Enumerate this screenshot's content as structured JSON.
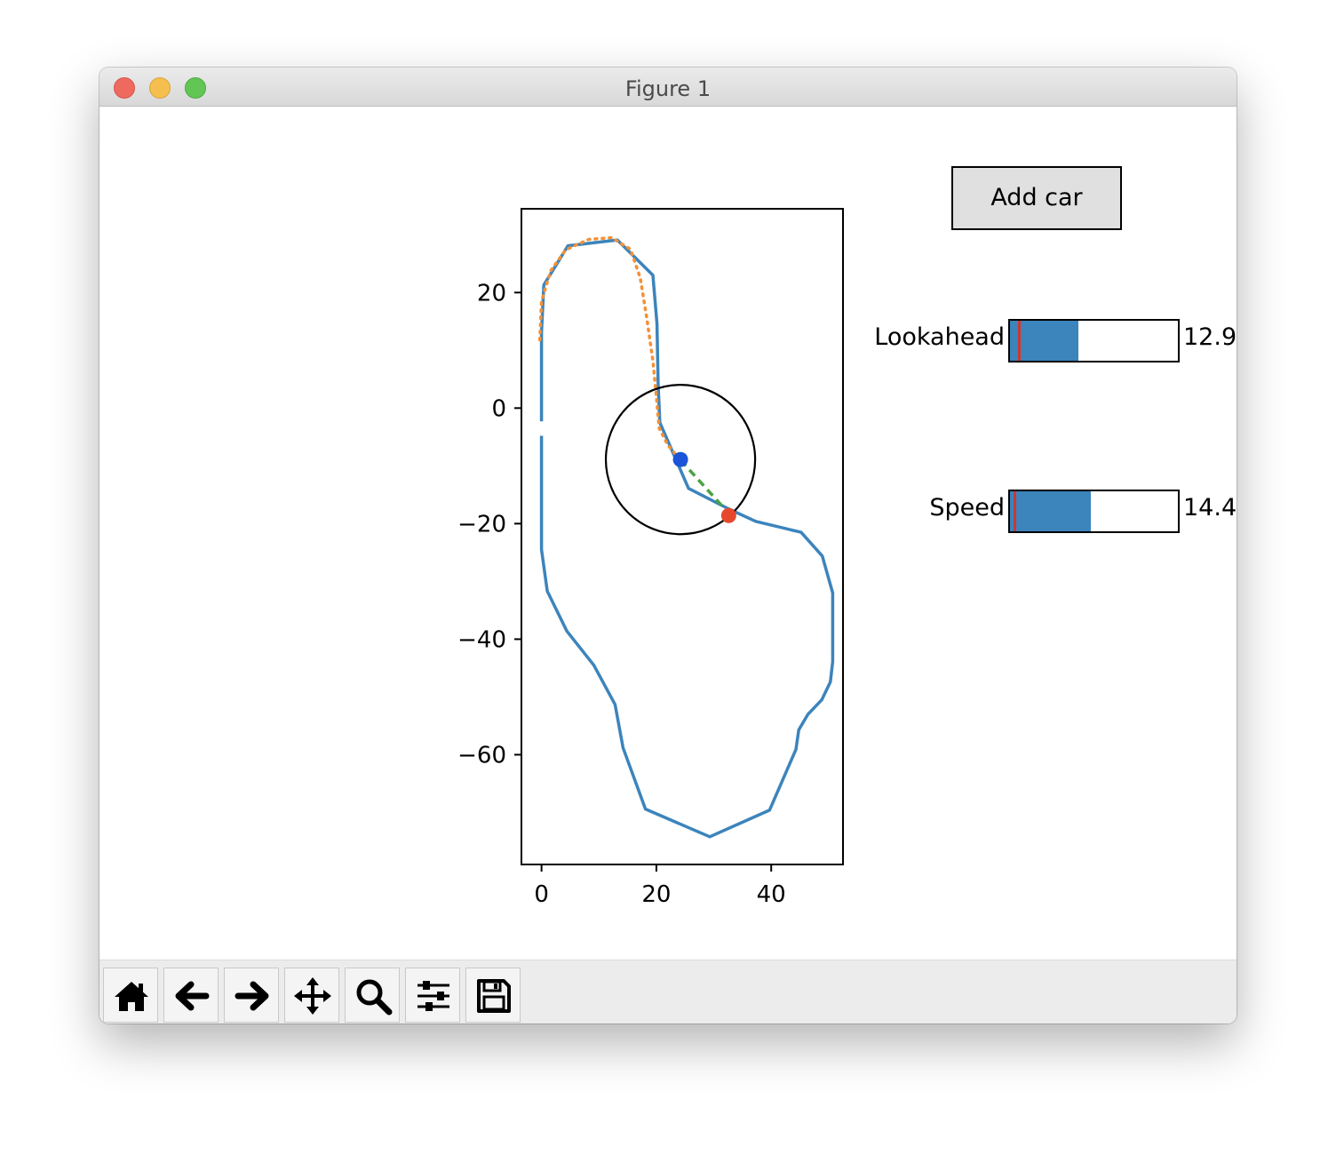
{
  "window": {
    "title": "Figure 1"
  },
  "figure": {
    "add_car_label": "Add car",
    "sliders": [
      {
        "label": "Lookahead",
        "value_text": "12.9",
        "fraction": 0.41,
        "initial_fraction": 0.05,
        "fill_color": "#3c84bc",
        "marker_color": "#d0362c"
      },
      {
        "label": "Speed",
        "value_text": "14.4",
        "fraction": 0.48,
        "initial_fraction": 0.02,
        "fill_color": "#3c84bc",
        "marker_color": "#d0362c"
      }
    ]
  },
  "chart_data": {
    "type": "line",
    "xlim": [
      -3.5,
      52.5
    ],
    "ylim": [
      -79,
      34.5
    ],
    "xticks": [
      0,
      20,
      40
    ],
    "yticks": [
      20,
      0,
      -20,
      -40,
      -60
    ],
    "xtick_labels": [
      "0",
      "20",
      "40"
    ],
    "ytick_labels": [
      "20",
      "0",
      "−20",
      "−40",
      "−60"
    ],
    "series": [
      {
        "style": "solid",
        "color": "#3c84bc",
        "points": [
          [
            0,
            -4.8
          ],
          [
            0,
            -24.5
          ],
          [
            1,
            -31.7
          ],
          [
            4.4,
            -38.6
          ],
          [
            9.1,
            -44.5
          ],
          [
            12.8,
            -51.3
          ],
          [
            14.2,
            -58.8
          ],
          [
            18.1,
            -69.4
          ],
          [
            29.3,
            -74.2
          ],
          [
            39.7,
            -69.6
          ],
          [
            44.3,
            -59.1
          ],
          [
            44.8,
            -55.7
          ],
          [
            46.4,
            -53.0
          ],
          [
            48.8,
            -50.5
          ],
          [
            50.3,
            -47.4
          ],
          [
            50.7,
            -43.9
          ],
          [
            50.7,
            -32.0
          ],
          [
            48.9,
            -25.6
          ],
          [
            45.2,
            -21.5
          ],
          [
            37.3,
            -19.6
          ],
          [
            32.5,
            -17.4
          ],
          [
            25.6,
            -13.9
          ],
          [
            20.6,
            -2.5
          ],
          [
            20.3,
            4.2
          ],
          [
            20.1,
            14.6
          ],
          [
            19.4,
            23.0
          ],
          [
            13.2,
            29.1
          ],
          [
            4.6,
            28.1
          ],
          [
            0.4,
            21.3
          ],
          [
            0,
            13.1
          ],
          [
            0,
            -2.3
          ]
        ]
      },
      {
        "style": "dotted",
        "color": "#f39137",
        "points": [
          [
            -0.3,
            11.8
          ],
          [
            0,
            18.5
          ],
          [
            1.6,
            23.8
          ],
          [
            4.2,
            27.4
          ],
          [
            8.2,
            29.2
          ],
          [
            12.2,
            29.5
          ],
          [
            15.5,
            27.5
          ],
          [
            17.2,
            22.5
          ],
          [
            18.3,
            15.8
          ],
          [
            19.4,
            8.2
          ],
          [
            20.0,
            2.0
          ],
          [
            20.5,
            -3.5
          ],
          [
            22.0,
            -6.4
          ],
          [
            24.2,
            -9.0
          ]
        ]
      },
      {
        "style": "dashed",
        "color": "#48a341",
        "points": [
          [
            24.2,
            -9.0
          ],
          [
            32.5,
            -18.1
          ]
        ]
      }
    ],
    "markers": [
      {
        "x": 24.2,
        "y": -8.9,
        "color": "#1a54d9"
      },
      {
        "x": 32.6,
        "y": -18.6,
        "color": "#e6482e"
      }
    ],
    "circle": {
      "cx": 24.2,
      "cy": -8.9,
      "r": 13.0,
      "color": "#000000"
    }
  },
  "toolbar": {
    "tools": [
      {
        "icon": "home-icon",
        "tooltip": "Reset original view"
      },
      {
        "icon": "arrow-left-icon",
        "tooltip": "Back to previous view"
      },
      {
        "icon": "arrow-right-icon",
        "tooltip": "Forward to next view"
      },
      {
        "icon": "move-icon",
        "tooltip": "Pan axes"
      },
      {
        "icon": "zoom-icon",
        "tooltip": "Zoom to rectangle"
      },
      {
        "icon": "sliders-icon",
        "tooltip": "Configure subplots"
      },
      {
        "icon": "save-icon",
        "tooltip": "Save the figure"
      }
    ]
  }
}
